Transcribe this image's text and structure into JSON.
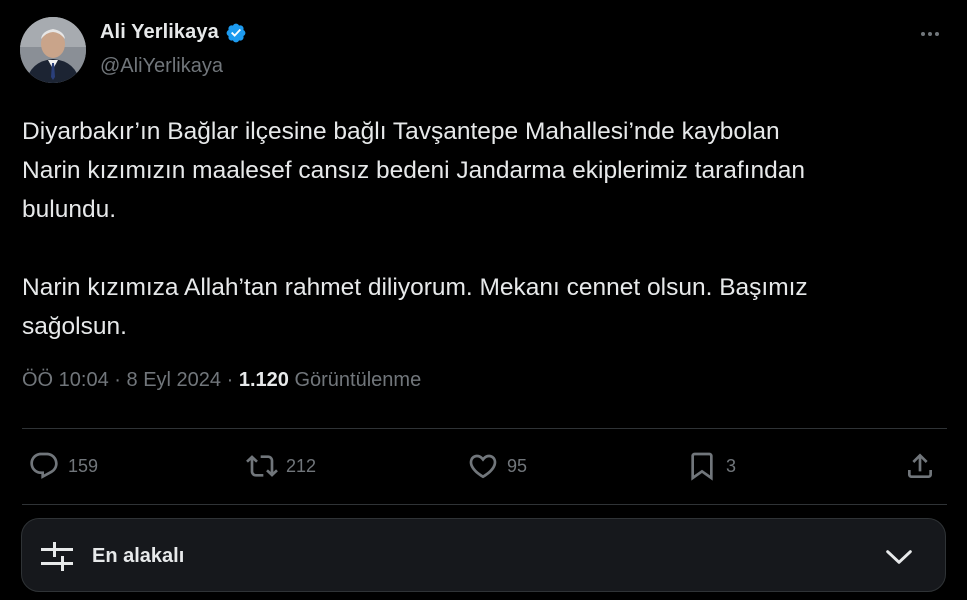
{
  "author": {
    "name": "Ali Yerlikaya",
    "handle": "@AliYerlikaya",
    "verified": true
  },
  "tweet": {
    "text": "Diyarbakır’ın Bağlar ilçesine bağlı Tavşantepe Mahallesi’nde kaybolan\nNarin kızımızın maalesef cansız bedeni Jandarma ekiplerimiz tarafından\nbulundu.\n\nNarin kızımıza Allah’tan rahmet diliyorum. Mekanı cennet olsun. Başımız\nsağolsun.",
    "time": "ÖÖ 10:04",
    "date": "8 Eyl 2024",
    "separator": "·",
    "views_count": "1.120",
    "views_label": "Görüntülenme"
  },
  "actions": {
    "reply_count": "159",
    "retweet_count": "212",
    "like_count": "95",
    "bookmark_count": "3"
  },
  "sort": {
    "label": "En alakalı"
  },
  "colors": {
    "background": "#000000",
    "text": "#e7e9ea",
    "muted": "#71767b",
    "verified": "#1d9bf0",
    "divider": "#2f3336"
  },
  "icons": [
    "verified-badge-icon",
    "more-icon",
    "reply-icon",
    "retweet-icon",
    "like-icon",
    "bookmark-icon",
    "share-icon",
    "sort-sliders-icon",
    "chevron-down-icon"
  ]
}
